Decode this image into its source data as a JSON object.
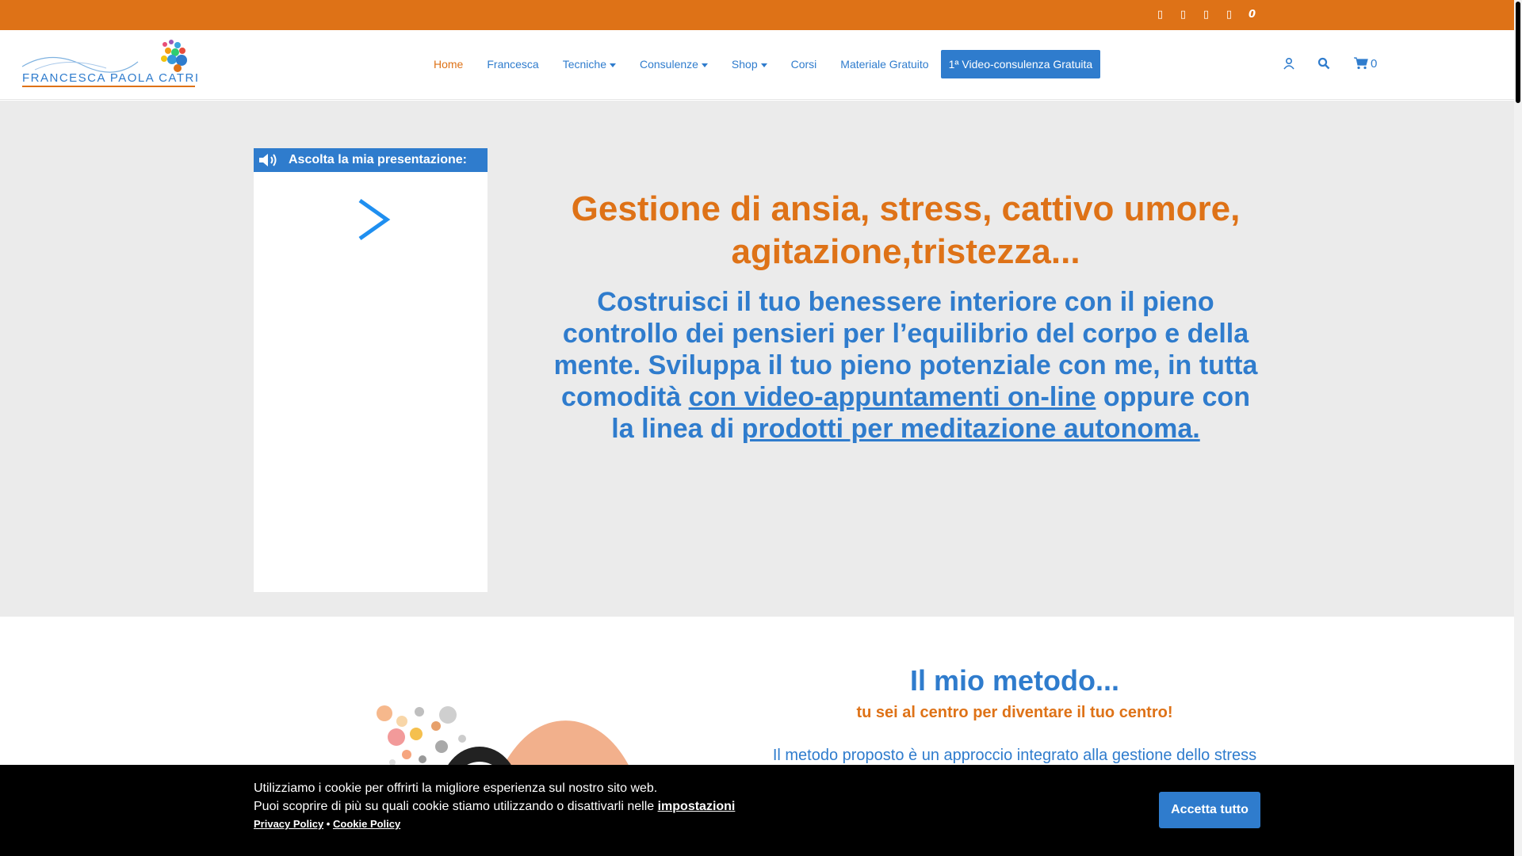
{
  "colors": {
    "accent_orange": "#de7217",
    "accent_blue": "#2f7ccd",
    "hero_bg": "#ebebeb",
    "cookie_bg": "#000000"
  },
  "topbar": {
    "social_icons": [
      "social-icon-1",
      "social-icon-2",
      "social-icon-3",
      "social-icon-4",
      "social-icon-5"
    ]
  },
  "logo": {
    "name": "FRANCESCA PAOLA CATRINI"
  },
  "nav": {
    "items": [
      {
        "label": "Home"
      },
      {
        "label": "Francesca"
      },
      {
        "label": "Tecniche"
      },
      {
        "label": "Consulenze"
      },
      {
        "label": "Shop"
      },
      {
        "label": "Corsi"
      },
      {
        "label": "Materiale Gratuito"
      }
    ],
    "cta": "1ª Video-consulenza Gratuita",
    "cart_count": "0"
  },
  "hero": {
    "audio_label": "Ascolta la mia presentazione:",
    "title": "Gestione di ansia, stress, cattivo umore, agitazione,tristezza...",
    "sub_part1": "Costruisci il tuo benessere interiore con il pieno controllo dei pensieri per l’equilibrio del corpo e della mente. Sviluppa il  tuo pieno potenziale con me, in tutta comodità ",
    "sub_link1": "con video-appuntamenti on-line",
    "sub_part2": " oppure con la linea di ",
    "sub_link2": "prodotti per meditazione autonoma. "
  },
  "method": {
    "title": "Il mio metodo...",
    "tagline": "tu sei al centro per diventare il tuo centro!",
    "body": "Il metodo proposto è un approccio integrato alla gestione dello stress"
  },
  "cookie": {
    "line1": "Utilizziamo i cookie per offrirti la migliore esperienza sul nostro sito web.",
    "line2": "Puoi scoprire di più su quali cookie stiamo utilizzando o disattivarli nelle ",
    "settings_link": "impostazioni",
    "privacy": "Privacy Policy",
    "separator": "•",
    "cookie_policy": "Cookie Policy",
    "accept": "Accetta tutto"
  }
}
